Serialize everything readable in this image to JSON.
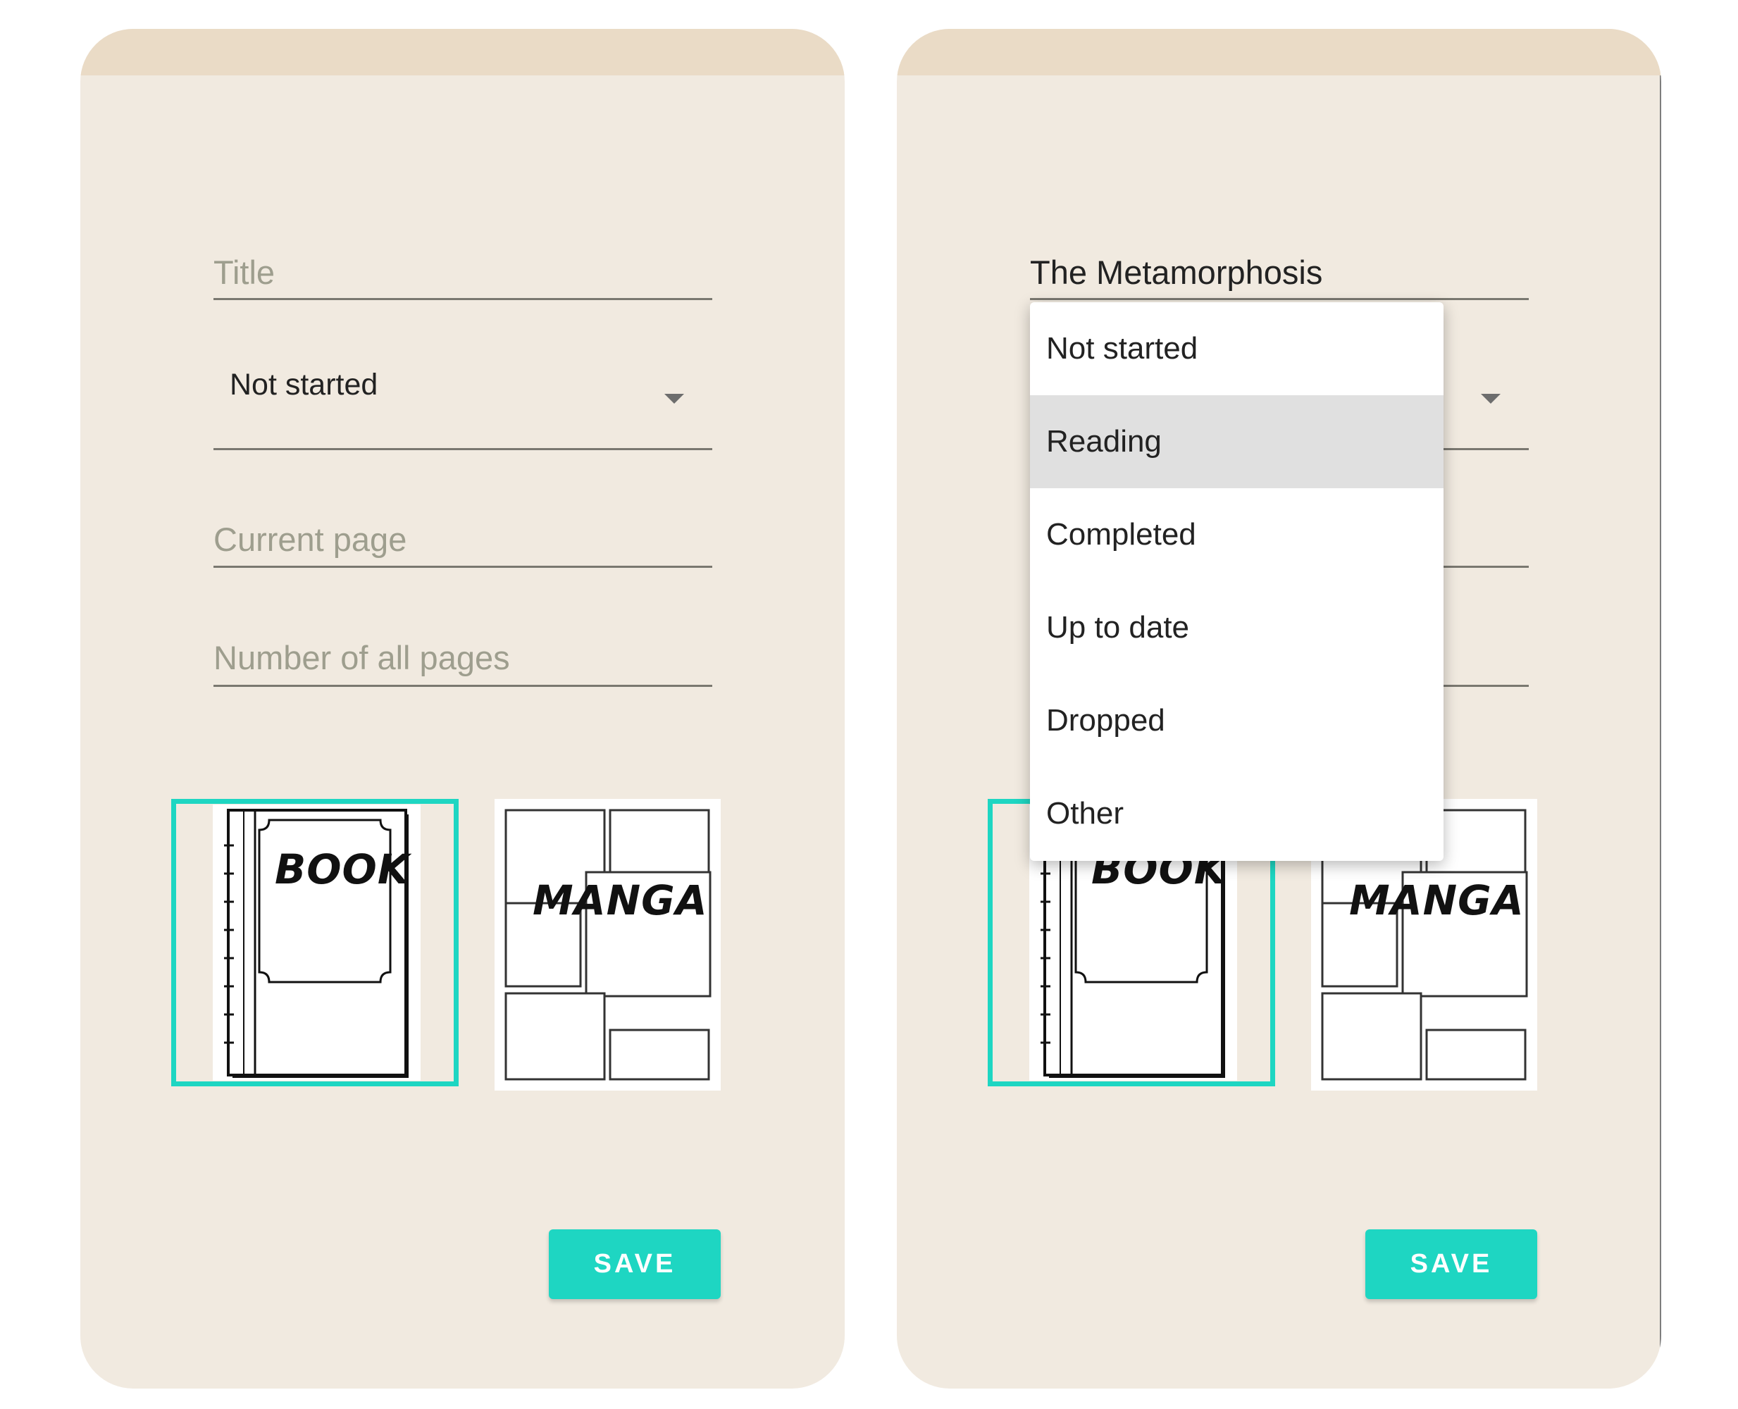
{
  "screens": [
    {
      "form": {
        "title_placeholder": "Title",
        "title_value": "",
        "status_value": "Not started",
        "current_page_placeholder": "Current page",
        "total_pages_placeholder": "Number of all pages"
      },
      "types": {
        "book_label": "BOOK",
        "manga_label": "MANGA",
        "selected": "BOOK"
      },
      "save_label": "SAVE"
    },
    {
      "form": {
        "title_value": "The Metamorphosis"
      },
      "dropdown": {
        "options": [
          "Not started",
          "Reading",
          "Completed",
          "Up to date",
          "Dropped",
          "Other"
        ],
        "highlighted": "Reading"
      },
      "types": {
        "book_label": "BOOK",
        "manga_label": "MANGA",
        "selected": "BOOK"
      },
      "save_label": "SAVE"
    }
  ],
  "colors": {
    "accent": "#1ed6c2",
    "card_background": "#f1eae0",
    "card_header": "#eadbc6"
  }
}
